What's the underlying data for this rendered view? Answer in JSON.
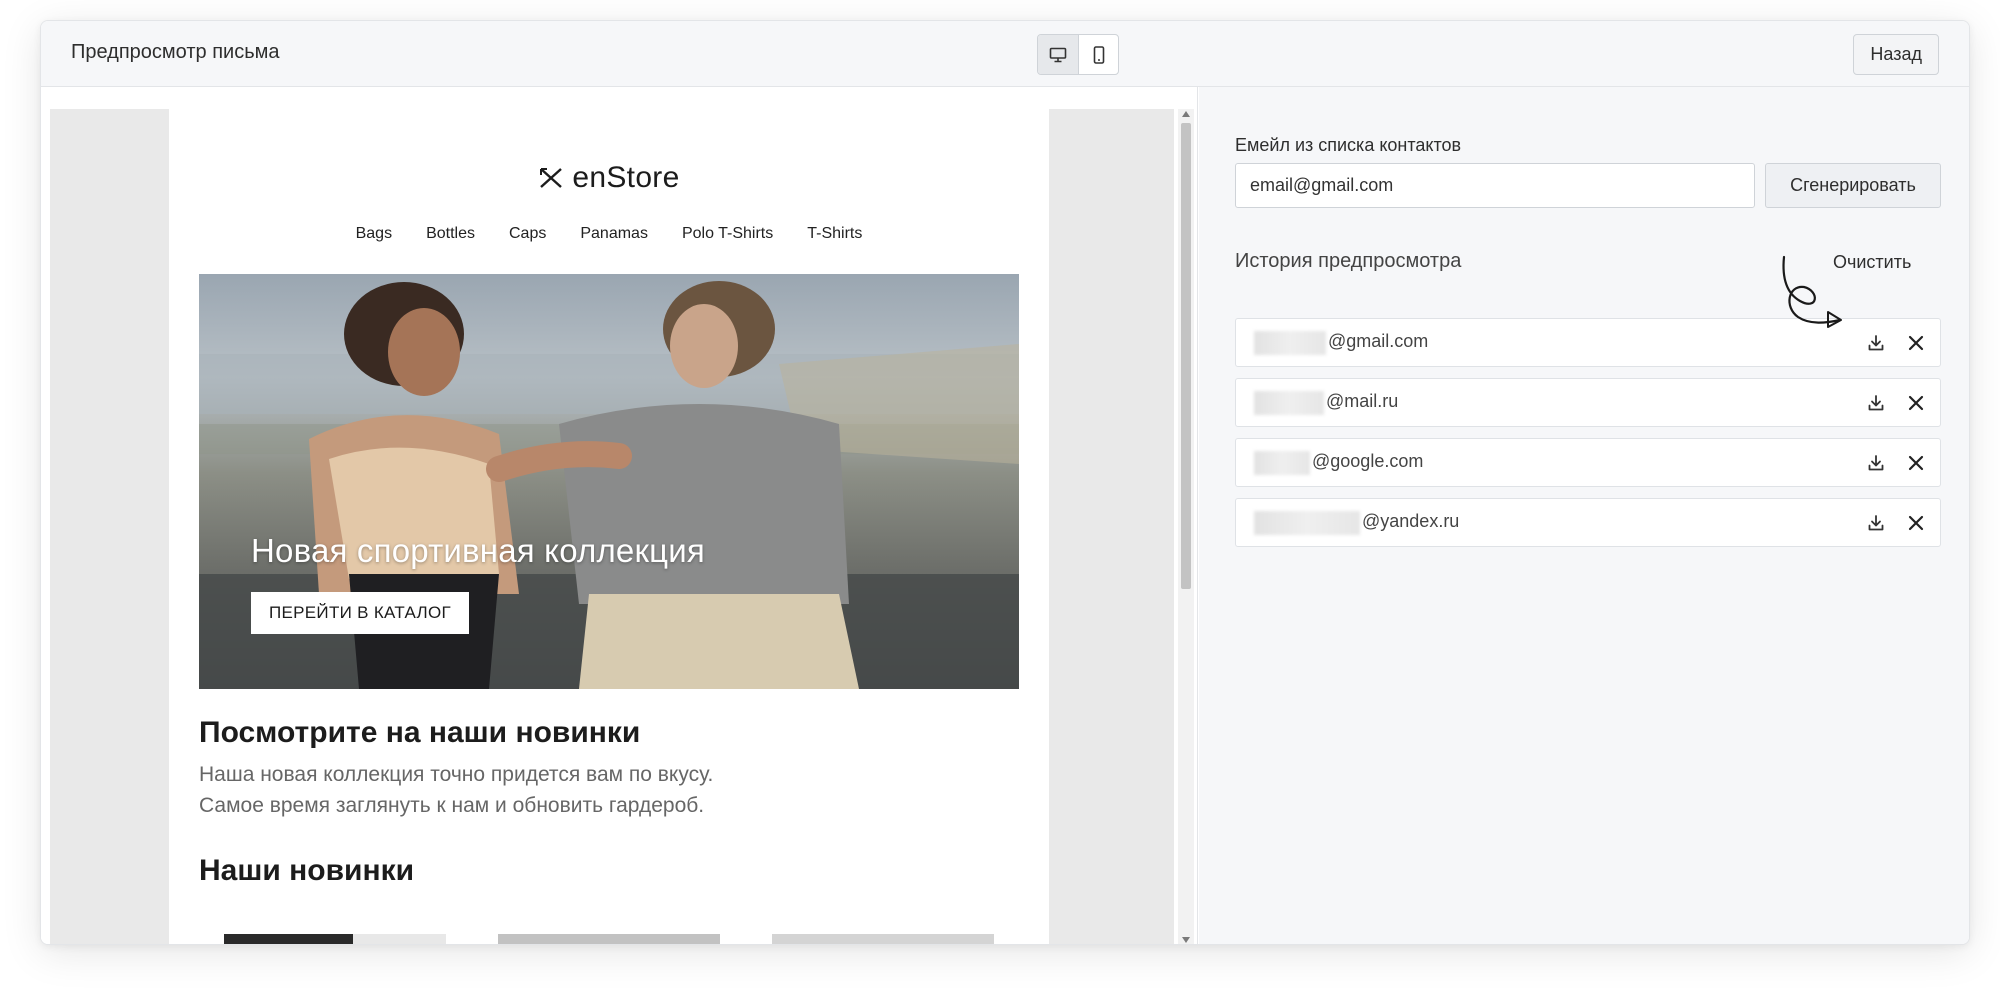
{
  "header": {
    "title": "Предпросмотр письма",
    "back_label": "Назад",
    "device_modes": [
      "desktop-icon",
      "mobile-icon"
    ]
  },
  "email": {
    "logo_text": "enStore",
    "nav": [
      "Bags",
      "Bottles",
      "Caps",
      "Panamas",
      "Polo T-Shirts",
      "T-Shirts"
    ],
    "hero_title": "Новая спортивная коллекция",
    "hero_button": "ПЕРЕЙТИ В КАТАЛОГ",
    "section_title": "Посмотрите на наши новинки",
    "section_text_1": "Наша новая коллекция точно придется вам по вкусу.",
    "section_text_2": "Самое время заглянуть к нам и обновить гардероб.",
    "section_title_2": "Наши новинки"
  },
  "sidebar": {
    "contact_label": "Емейл из списка контактов",
    "email_value": "email@gmail.com",
    "generate_label": "Сгенерировать",
    "history_label": "История предпросмотра",
    "clear_label": "Очистить",
    "history": [
      {
        "domain": "@gmail.com"
      },
      {
        "domain": "@mail.ru"
      },
      {
        "domain": "@google.com"
      },
      {
        "domain": "@yandex.ru"
      }
    ]
  },
  "colors": {
    "panel_bg": "#f6f7f9",
    "border": "#cfd3d8",
    "text": "#2e2e2e"
  }
}
